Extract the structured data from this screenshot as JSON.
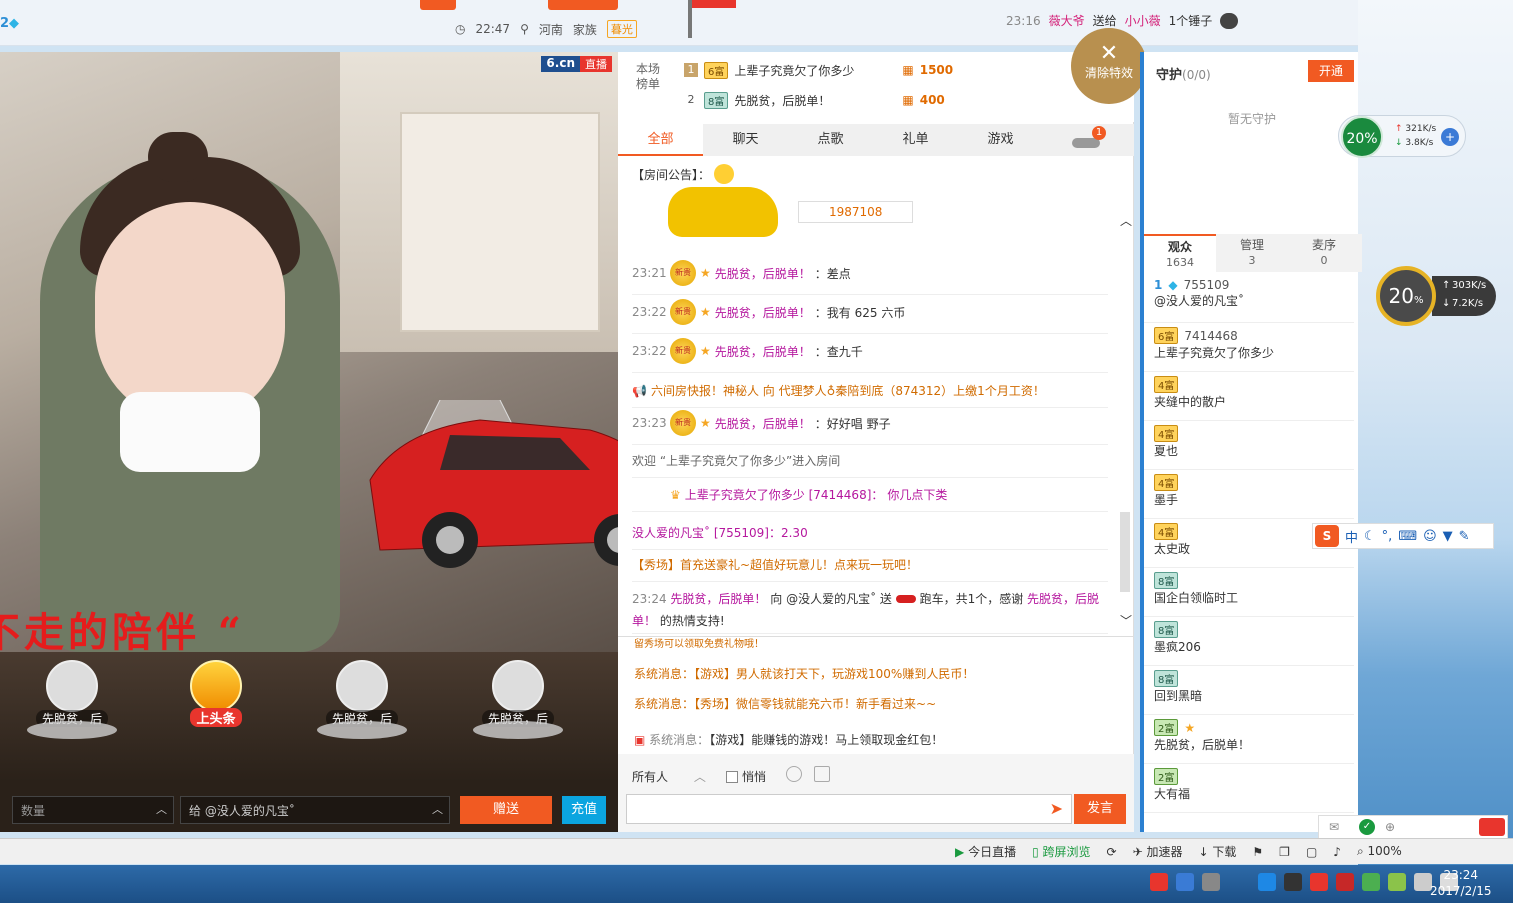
{
  "topbar": {
    "level": "2",
    "time": "22:47",
    "location": "河南",
    "family_label": "家族",
    "family_badge": "暮光",
    "gift_log": {
      "time": "23:16",
      "from": "薇大爷",
      "action": "送给",
      "to": "小小薇",
      "gift": "1个锤子"
    }
  },
  "video": {
    "logo": "6.cn",
    "live_tag": "直播",
    "caption": "不走的陪伴 “"
  },
  "seats": [
    {
      "name": "先脱贫，后"
    },
    {
      "name": "上头条"
    },
    {
      "name": "先脱贫，后"
    },
    {
      "name": "先脱贫，后"
    }
  ],
  "giftbar": {
    "qty_placeholder": "数量",
    "to_label": "给 @没人爱的凡宝˚",
    "send": "赠送",
    "recharge": "充值"
  },
  "rank": {
    "label": "本场榜单",
    "rows": [
      {
        "idx": "1",
        "level": "6富",
        "name": "上辈子究竟欠了你多少",
        "coins": "1500"
      },
      {
        "idx": "2",
        "level": "8富",
        "name": "先脱贫，后脱单！",
        "coins": "400"
      }
    ]
  },
  "clear_fx": {
    "label": "清除特效"
  },
  "tabs": [
    "全部",
    "聊天",
    "点歌",
    "礼单",
    "游戏"
  ],
  "car_badge": "1",
  "messages": {
    "announcement": "【房间公告】：",
    "car_id": "1987108",
    "rows": [
      {
        "time": "23:21",
        "name": "先脱贫，后脱单！",
        "text": "：差点"
      },
      {
        "time": "23:22",
        "name": "先脱贫，后脱单！",
        "text": "：我有 625 六币"
      },
      {
        "time": "23:22",
        "name": "先脱贫，后脱单！",
        "text": "：查九千"
      },
      {
        "time": "23:23",
        "name": "先脱贫，后脱单！",
        "text": "：好好唱 野子"
      }
    ],
    "quick_news": "六间房快报！神秘人 向 代理梦人♁秦陪到底（874312）上缴1个月工资！",
    "welcome": "欢迎 “上辈子究竟欠了你多少”进入房间",
    "user_msg_name": "上辈子究竟欠了你多少 [7414468]：",
    "user_msg_text": "你几点下类",
    "amount_msg": "没人爱的凡宝˚ [755109]：2.30",
    "promo": "【秀场】首充送豪礼~超值好玩意儿！点来玩一玩吧！",
    "gift_time": "23:24",
    "gift_from": "先脱贫，后脱单！",
    "gift_mid": "向 @没人爱的凡宝˚ 送",
    "gift_item": "跑车，共1个，感谢",
    "gift_thanks_name": "先脱贫，后脱单！",
    "gift_end": "的热情支持!"
  },
  "system": {
    "label": "系统消息：",
    "partial": "留秀场可以领取免费礼物哦！",
    "rows": [
      "【游戏】男人就该打天下，玩游戏100%赚到人民币！",
      "【秀场】微信零钱就能充六币！新手看过来~~",
      "【游戏】能赚钱的游戏！马上领取现金红包！"
    ]
  },
  "input": {
    "to": "所有人",
    "whisper": "悄悄",
    "send": "发言"
  },
  "guard": {
    "title": "守护",
    "count": "(0/0)",
    "open": "开通",
    "empty": "暂无守护"
  },
  "ptabs": [
    {
      "label": "观众",
      "count": "1634"
    },
    {
      "label": "管理",
      "count": "3"
    },
    {
      "label": "麦序",
      "count": "0"
    }
  ],
  "audience": [
    {
      "level": "1",
      "id": "755109",
      "name": "@没人爱的凡宝˚"
    },
    {
      "level": "6富",
      "id": "7414468",
      "name": "上辈子究竟欠了你多少"
    },
    {
      "level": "4富",
      "id": "",
      "name": "夹缝中的散户"
    },
    {
      "level": "4富",
      "id": "",
      "name": "夏也"
    },
    {
      "level": "4富",
      "id": "",
      "name": "墨手"
    },
    {
      "level": "4富",
      "id": "",
      "name": "太史政"
    },
    {
      "level": "8富",
      "id": "",
      "name": "国企白领临时工"
    },
    {
      "level": "8富",
      "id": "",
      "name": "墨疯206"
    },
    {
      "level": "8富",
      "id": "",
      "name": "回到黑暗"
    },
    {
      "level": "2富",
      "id": "",
      "name": "先脱贫，后脱单！"
    },
    {
      "level": "2富",
      "id": "",
      "name": "大有福"
    }
  ],
  "speed1": {
    "pct": "20%",
    "up": "321K/s",
    "down": "3.8K/s"
  },
  "speed2": {
    "pct": "20",
    "up": "303K/s",
    "down": "7.2K/s"
  },
  "ime": {
    "mode": "中"
  },
  "statusbar": {
    "today_live": "今日直播",
    "cross_screen": "跨屏浏览",
    "accelerator": "加速器",
    "download": "下载",
    "zoom": "100%"
  },
  "taskbar": {
    "time": "23:24",
    "date": "2017/2/15"
  }
}
